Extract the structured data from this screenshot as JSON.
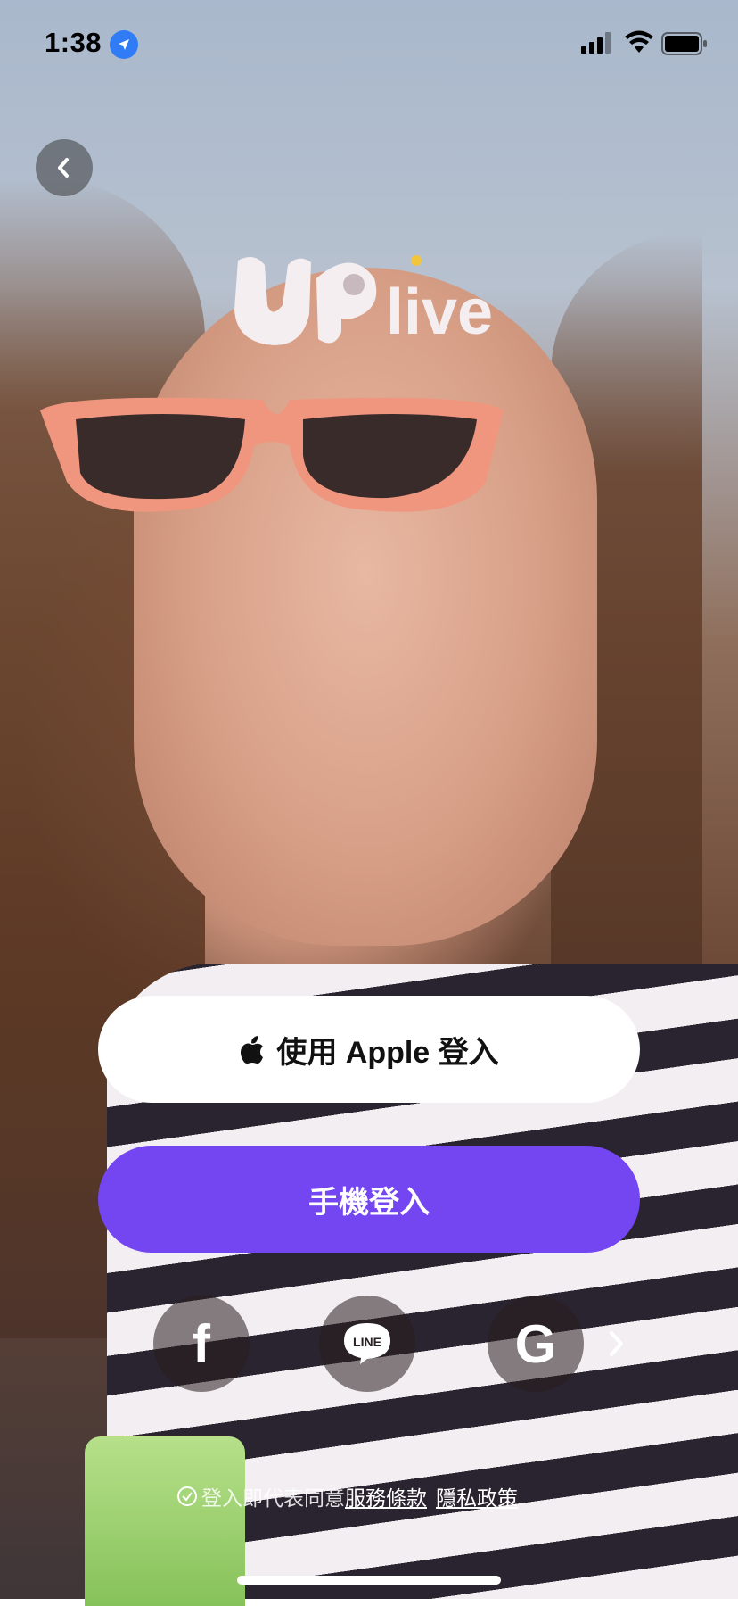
{
  "status_bar": {
    "time": "1:38"
  },
  "logo": {
    "text": "live"
  },
  "auth": {
    "apple_label": "使用 Apple 登入",
    "phone_label": "手機登入"
  },
  "social": {
    "facebook_glyph": "f",
    "line_glyph": "LINE",
    "google_glyph": "G"
  },
  "terms": {
    "prefix": "登入即代表同意",
    "terms_link": "服務條款",
    "privacy_link": "隱私政策"
  },
  "colors": {
    "phone_button": "#7446f2",
    "apple_button": "#ffffff"
  },
  "icons": [
    "location-arrow-icon",
    "signal-icon",
    "wifi-icon",
    "battery-icon",
    "back-chevron-icon",
    "apple-icon",
    "facebook-icon",
    "line-icon",
    "google-icon",
    "chevron-right-icon",
    "check-circle-icon"
  ]
}
